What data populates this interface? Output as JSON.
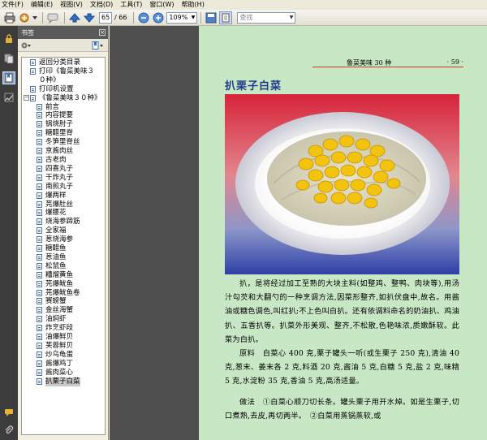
{
  "menu": [
    "文件(F)",
    "编辑(E)",
    "视图(V)",
    "文档(D)",
    "工具(T)",
    "窗口(W)",
    "帮助(H)"
  ],
  "toolbar": {
    "current_page": "65",
    "total_pages": "/ 66",
    "zoom": "109%",
    "search_placeholder": "查找"
  },
  "bookmarks_panel": {
    "title": "书签",
    "items": [
      {
        "label": "返回分类目录",
        "level": 0
      },
      {
        "label": "打印《鲁菜美味３０种》",
        "level": 0
      },
      {
        "label": "打印机设置",
        "level": 0
      },
      {
        "label": "《鲁菜美味３０种》",
        "level": 0,
        "expander": "⊟"
      },
      {
        "label": "前言",
        "level": 1
      },
      {
        "label": "内容提要",
        "level": 1
      },
      {
        "label": "锅烧肘子",
        "level": 1
      },
      {
        "label": "糖醋里脊",
        "level": 1
      },
      {
        "label": "冬笋里脊丝",
        "level": 1
      },
      {
        "label": "京酱肉丝",
        "level": 1
      },
      {
        "label": "古老肉",
        "level": 1
      },
      {
        "label": "四喜丸子",
        "level": 1
      },
      {
        "label": "干炸丸子",
        "level": 1
      },
      {
        "label": "南煎丸子",
        "level": 1
      },
      {
        "label": "爆两样",
        "level": 1
      },
      {
        "label": "芫爆肚丝",
        "level": 1
      },
      {
        "label": "爆腰花",
        "level": 1
      },
      {
        "label": "烧海参蹄筋",
        "level": 1
      },
      {
        "label": "全家福",
        "level": 1
      },
      {
        "label": "葱烧海参",
        "level": 1
      },
      {
        "label": "糖醋鱼",
        "level": 1
      },
      {
        "label": "葱油鱼",
        "level": 1
      },
      {
        "label": "松鼠鱼",
        "level": 1
      },
      {
        "label": "糟熘黄鱼",
        "level": 1
      },
      {
        "label": "芫爆鱿鱼",
        "level": 1
      },
      {
        "label": "芫爆鱿鱼卷",
        "level": 1
      },
      {
        "label": "赛螃蟹",
        "level": 1
      },
      {
        "label": "金丝海蟹",
        "level": 1
      },
      {
        "label": "油焖虾",
        "level": 1
      },
      {
        "label": "炸烹虾段",
        "level": 1
      },
      {
        "label": "油爆鲜贝",
        "level": 1
      },
      {
        "label": "芙蓉鲜贝",
        "level": 1
      },
      {
        "label": "炒乌龟蛋",
        "level": 1
      },
      {
        "label": "酱爆鸡丁",
        "level": 1
      },
      {
        "label": "酱肉菜心",
        "level": 1
      },
      {
        "label": "扒栗子白菜",
        "level": 1,
        "selected": true
      }
    ]
  },
  "page": {
    "running_title": "鲁菜美味 30 种",
    "page_number": "· 59 ·",
    "dish_title": "扒栗子白菜",
    "paragraph1": "扒，是将经过加工至熟的大块主料(如整鸡、整鸭、肉块等),用汤汁勾芡和大翻勺的一种烹调方法,因菜形整齐,如扒伏盘中,故名。用酱油或糖色调色,叫红扒;不上色叫白扒。还有依调料命名的奶油扒、鸡油扒、五香扒等。扒菜外形美观、整齐,不松散,色艳味浓,质嫩酥软。此菜为白扒。",
    "paragraph2": "原料　白菜心 400 克,栗子罐头一听(或生栗子 250 克),清油 40 克,葱末、姜末各 2 克,料酒 20 克,酱油 5 克,白糖 5 克,盐 2 克,味精 5 克,水淀粉 35 克,香油 5 克,高汤适量。",
    "paragraph3": "做法　①白菜心顺刀切长条。罐头栗子用开水焯。如是生栗子,切口煮熟,去皮,再切两半。　②白菜用蒸锅蒸软,或"
  },
  "colors": {
    "page_bg": "#c8e7c4",
    "dish_title": "#1e3a8a",
    "rule": "#c0392b"
  }
}
